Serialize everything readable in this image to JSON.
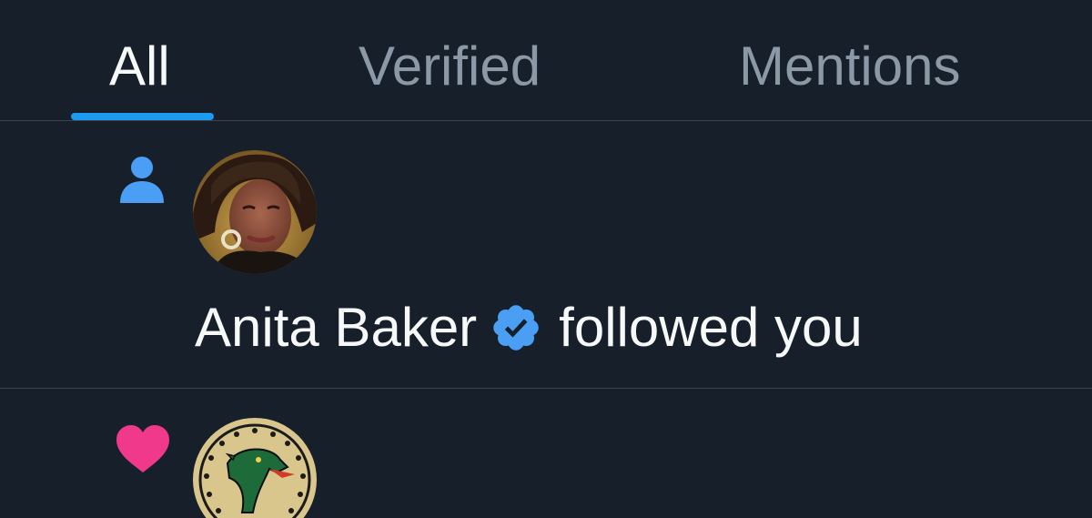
{
  "tabs": {
    "all": "All",
    "verified": "Verified",
    "mentions": "Mentions",
    "active": "all"
  },
  "notifications": [
    {
      "type": "follow",
      "type_icon": "person-icon",
      "user_name": "Anita Baker",
      "verified": true,
      "action_text": "followed you"
    },
    {
      "type": "like",
      "type_icon": "heart-icon",
      "avatar": "uab-dragon-logo"
    }
  ],
  "colors": {
    "background": "#161f2a",
    "accent": "#1d9bf0",
    "like": "#f91880",
    "tab_inactive": "#8b98a5",
    "divider": "#38444d"
  }
}
